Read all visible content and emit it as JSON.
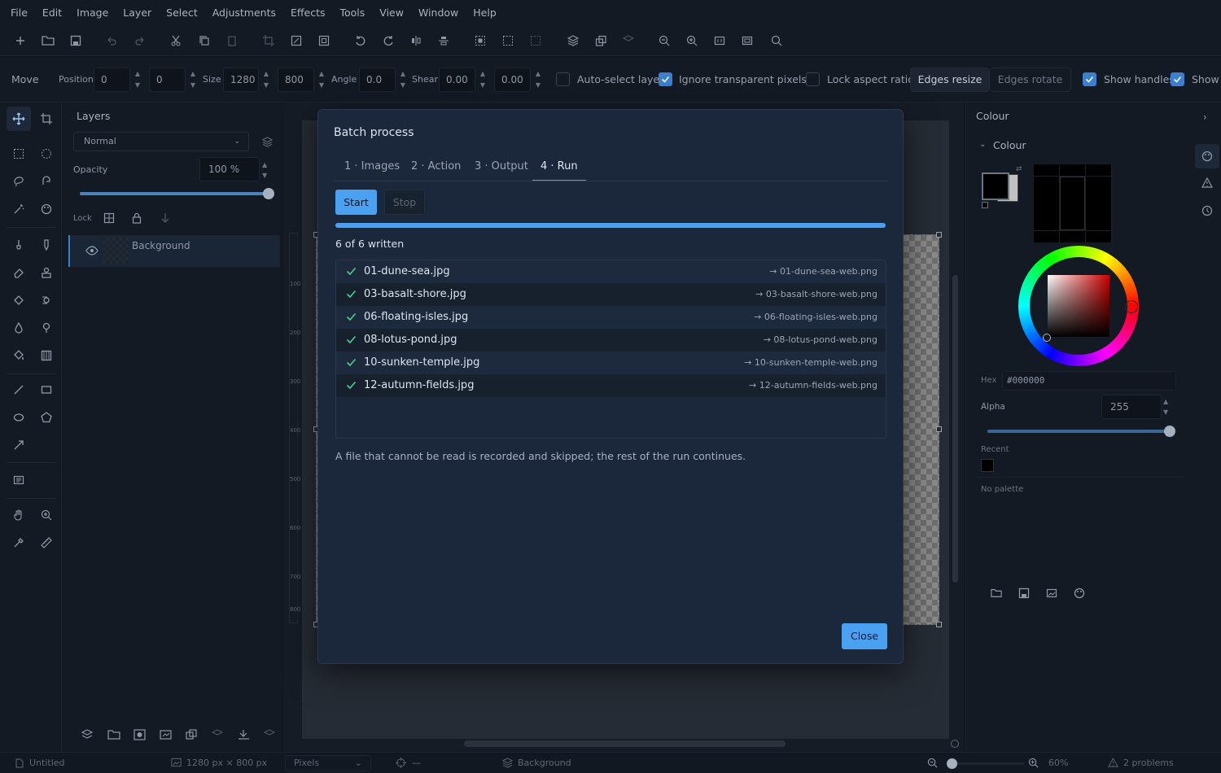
{
  "menu": [
    "File",
    "Edit",
    "Image",
    "Layer",
    "Select",
    "Adjustments",
    "Effects",
    "Tools",
    "View",
    "Window",
    "Help"
  ],
  "options": {
    "tool_name": "Move",
    "position_label": "Position",
    "pos_x": "0",
    "pos_y": "0",
    "size_label": "Size",
    "size_w": "1280",
    "size_h": "800",
    "angle_label": "Angle",
    "angle": "0.0",
    "shear_label": "Shear",
    "shear_x": "0.00",
    "shear_y": "0.00",
    "auto_select": "Auto-select layer",
    "ignore_transparent": "Ignore transparent pixels",
    "lock_aspect": "Lock aspect ratio",
    "edges_resize": "Edges resize",
    "edges_rotate": "Edges rotate",
    "show_handles": "Show handles",
    "show_extra": "Show"
  },
  "layers": {
    "title": "Layers",
    "blend_mode": "Normal",
    "opacity_label": "Opacity",
    "opacity_value": "100 %",
    "opacity": 1.0,
    "lock_label": "Lock",
    "items": [
      {
        "name": "Background"
      }
    ]
  },
  "ruler": [
    "100",
    "200",
    "300",
    "400",
    "500",
    "600",
    "700",
    "800"
  ],
  "colour": {
    "header": "Colour",
    "section": "Colour",
    "hex_label": "Hex",
    "hex_value": "#000000",
    "alpha_label": "Alpha",
    "alpha_value": "255",
    "recent_label": "Recent",
    "palette_label": "No palette",
    "primary": "#000000",
    "secondary": "#c0c0c0"
  },
  "dialog": {
    "title": "Batch process",
    "tabs": [
      "1 · Images",
      "2 · Action",
      "3 · Output",
      "4 · Run"
    ],
    "active_tab": 3,
    "start_label": "Start",
    "stop_label": "Stop",
    "progress": 1.0,
    "status": "6 of 6 written",
    "files": [
      {
        "name": "01-dune-sea.jpg",
        "output": "→ 01-dune-sea-web.png"
      },
      {
        "name": "03-basalt-shore.jpg",
        "output": "→ 03-basalt-shore-web.png"
      },
      {
        "name": "06-floating-isles.jpg",
        "output": "→ 06-floating-isles-web.png"
      },
      {
        "name": "08-lotus-pond.jpg",
        "output": "→ 08-lotus-pond-web.png"
      },
      {
        "name": "10-sunken-temple.jpg",
        "output": "→ 10-sunken-temple-web.png"
      },
      {
        "name": "12-autumn-fields.jpg",
        "output": "→ 12-autumn-fields-web.png"
      }
    ],
    "note": "A file that cannot be read is recorded and skipped; the rest of the run continues.",
    "close_label": "Close",
    "accent": "#4aa1f2"
  },
  "status": {
    "document": "Untitled",
    "dimensions": "1280 px × 800 px",
    "units": "Pixels",
    "cursor": "—",
    "layer": "Background",
    "zoom": "60%",
    "problems": "2 problems"
  }
}
